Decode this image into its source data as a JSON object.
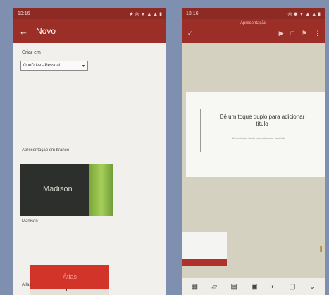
{
  "left_phone": {
    "status_time": "13:16",
    "status_icons": "★ ◎ ▼ ▲ ▲ ▮",
    "back_label": "←",
    "title": "Novo",
    "create_in_label": "Criar em",
    "location_select": {
      "value": "OneDrive - Pessoal",
      "caret": "▾"
    },
    "section_label": "Apresentação em branco",
    "templates": [
      {
        "preview_text": "Madison",
        "caption": "Madison"
      },
      {
        "preview_text": "Átlas",
        "caption": "Atlas"
      }
    ]
  },
  "right_phone": {
    "status_time": "13:16",
    "status_icons": "◎ ◉ ▼ ▲ ▲ ▮",
    "doc_title": "Apresentação",
    "check_icon": "✓",
    "toolbar_icons": [
      "▶",
      "□",
      "⚑",
      "⋮"
    ],
    "slide": {
      "title_placeholder": "Dê um toque duplo para adicionar título",
      "subtitle_placeholder": "dê um toque duplo para adicionar subtítulo"
    },
    "bottom_icons": [
      "▦",
      "▱",
      "▤",
      "▣",
      "◐",
      "▢",
      "⌄"
    ]
  },
  "colors": {
    "accent": "#9b2f27",
    "status": "#8e2a24",
    "template_red": "#d2342a",
    "template_green": "#7aa83a"
  }
}
